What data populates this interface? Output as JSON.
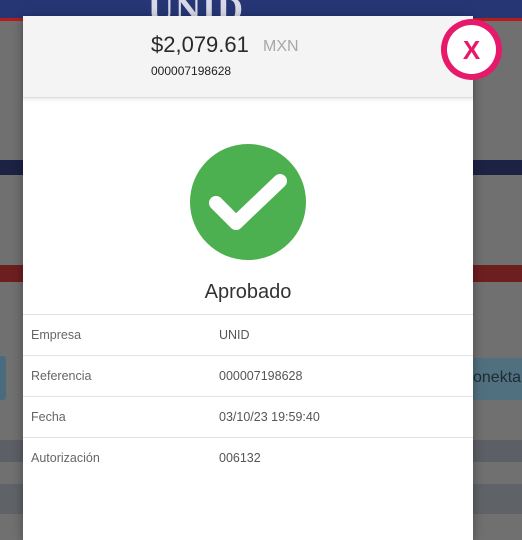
{
  "background": {
    "logo_text": "UNID",
    "right_button_text": "onekta"
  },
  "modal": {
    "amount": "$2,079.61",
    "currency": "MXN",
    "reference": "000007198628",
    "status_icon": "check-icon",
    "status_color": "#4caf50",
    "status_text": "Aprobado",
    "details": [
      {
        "label": "Empresa",
        "value": "UNID"
      },
      {
        "label": "Referencia",
        "value": "000007198628"
      },
      {
        "label": "Fecha",
        "value": "03/10/23 19:59:40"
      },
      {
        "label": "Autorización",
        "value": "006132"
      }
    ]
  },
  "close_button": {
    "label": "X",
    "color": "#e6196a"
  }
}
